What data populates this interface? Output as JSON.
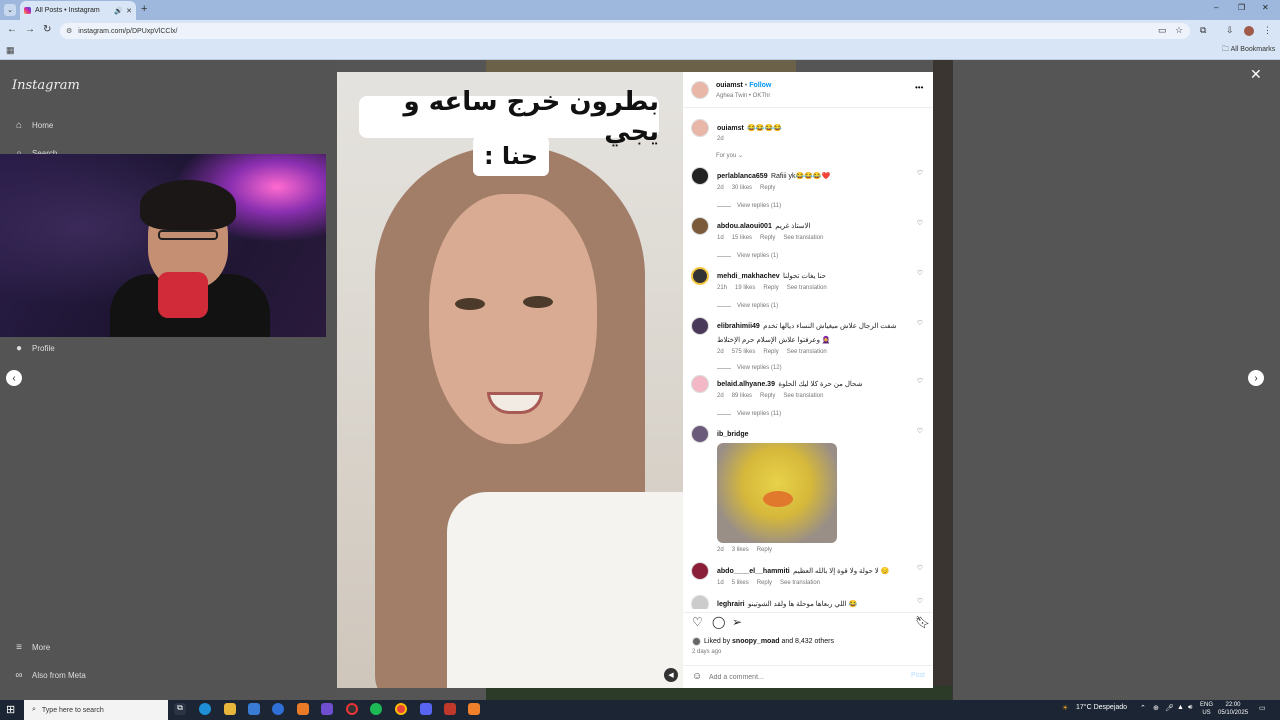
{
  "browser": {
    "tab_title": "All Posts • Instagram",
    "new_tab_symbol": "+",
    "url": "instagram.com/p/DPUxpVlCClx/",
    "all_bookmarks": "All Bookmarks",
    "window_controls": [
      "–",
      "❐",
      "✕"
    ]
  },
  "sidebar": {
    "logo": "Instagram",
    "items": [
      {
        "icon": "⌂",
        "label": "Home"
      },
      {
        "icon": "⌕",
        "label": "Search"
      },
      {
        "icon": "●",
        "label": "Profile"
      },
      {
        "icon": "≡",
        "label": "More"
      },
      {
        "icon": "∞",
        "label": "Also from Meta"
      }
    ]
  },
  "post": {
    "caption_line1": "بطرون خرج ساعه و يجي",
    "caption_line2": "حنا :",
    "header": {
      "username": "ouiamst",
      "follow": "Follow",
      "audio": "Aghea Twin • OKThr",
      "more": "•••"
    },
    "caption_comment": {
      "username": "ouiamst",
      "text": "😂😂😂😂",
      "time": "2d"
    },
    "for_you": "For you ⌄",
    "comments": [
      {
        "username": "perlablanca659",
        "text": "Rafiii yk😂😂😂❤️",
        "time": "2d",
        "likes": "30 likes",
        "reply": "Reply",
        "see_translation": "",
        "view_replies": "View replies (11)"
      },
      {
        "username": "abdou.alaoui001",
        "text": "الاستاذ غريم",
        "time": "1d",
        "likes": "15 likes",
        "reply": "Reply",
        "see_translation": "See translation",
        "view_replies": "View replies (1)"
      },
      {
        "username": "mehdi_makhachev",
        "text": "حنا يغات تحولنا",
        "time": "21h",
        "likes": "19 likes",
        "reply": "Reply",
        "see_translation": "See translation",
        "view_replies": "View replies (1)"
      },
      {
        "username": "elibrahimii49",
        "text": "شفت الرجال علاش ميغياش النساء ديالها تخدم وعرفتوا علاش الإسلام حرم الإختلاط 🧕",
        "time": "2d",
        "likes": "575 likes",
        "reply": "Reply",
        "see_translation": "See translation",
        "view_replies": "View replies (12)"
      },
      {
        "username": "belaid.alhyane.39",
        "text": "شحال من حرة كلا ليك الحلوة",
        "time": "2d",
        "likes": "89 likes",
        "reply": "Reply",
        "see_translation": "See translation",
        "view_replies": "View replies (11)"
      }
    ],
    "gif_comment": {
      "username": "ib_bridge",
      "time": "2d",
      "likes": "3 likes",
      "reply": "Reply"
    },
    "late_comments": [
      {
        "username": "abdo____el__hammiti",
        "text": "لا حولة ولا قوة إلا بالله العظيم 😔",
        "time": "1d",
        "likes": "5 likes",
        "reply": "Reply",
        "see_translation": "See translation"
      },
      {
        "username": "leghrairi",
        "text": "اللي ربعاها موحلة ها ولقد الشوتينو 😂"
      }
    ],
    "liked_by_prefix": "Liked by",
    "liked_by_user": "snoopy_moad",
    "liked_by_suffix": "and 8,432 others",
    "posted": "2 days ago",
    "add_comment_placeholder": "Add a comment...",
    "post_button": "Post"
  },
  "taskbar": {
    "search_placeholder": "Type here to search",
    "weather": "17°C  Despejado",
    "lang_line1": "ENG",
    "lang_line2": "US",
    "time": "22:00",
    "date": "05/10/2025"
  }
}
